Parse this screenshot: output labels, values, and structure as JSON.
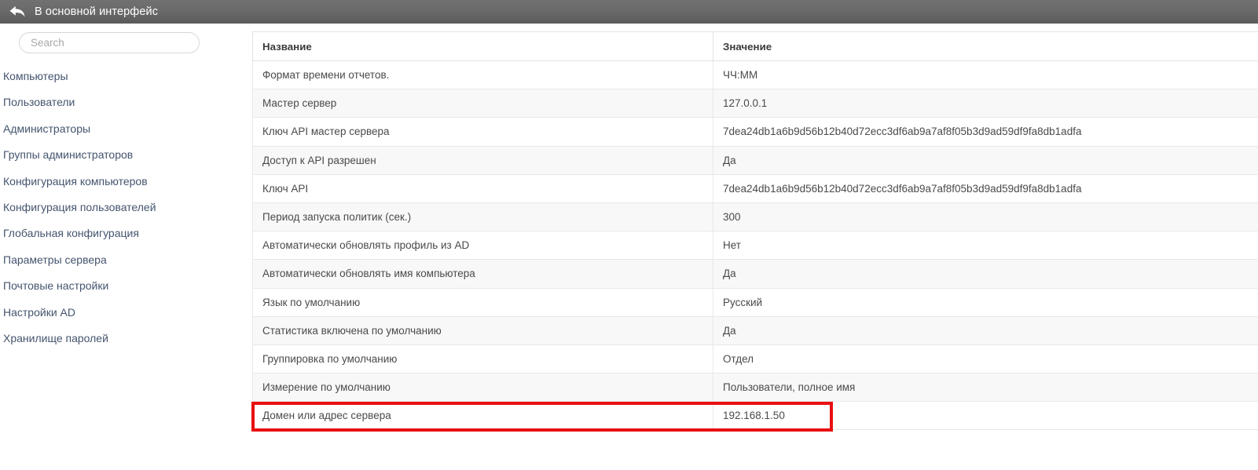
{
  "topbar": {
    "back_label": "В основной интерфейс",
    "back_icon": "back-arrow-icon",
    "bg_color": "#696969"
  },
  "sidebar": {
    "search": {
      "placeholder": "Search",
      "value": ""
    },
    "items": [
      {
        "label": "Компьютеры"
      },
      {
        "label": "Пользователи"
      },
      {
        "label": "Администраторы"
      },
      {
        "label": "Группы администраторов"
      },
      {
        "label": "Конфигурация компьютеров"
      },
      {
        "label": "Конфигурация пользователей"
      },
      {
        "label": "Глобальная конфигурация"
      },
      {
        "label": "Параметры сервера"
      },
      {
        "label": "Почтовые настройки"
      },
      {
        "label": "Настройки AD"
      },
      {
        "label": "Хранилище паролей"
      }
    ],
    "link_color": "#44546e"
  },
  "table": {
    "columns": [
      "Название",
      "Значение"
    ],
    "rows": [
      {
        "name": "Формат времени отчетов.",
        "value": "ЧЧ:ММ"
      },
      {
        "name": "Мастер сервер",
        "value": "127.0.0.1"
      },
      {
        "name": "Ключ API мастер сервера",
        "value": "7dea24db1a6b9d56b12b40d72ecc3df6ab9a7af8f05b3d9ad59df9fa8db1adfa"
      },
      {
        "name": "Доступ к API разрешен",
        "value": "Да"
      },
      {
        "name": "Ключ API",
        "value": "7dea24db1a6b9d56b12b40d72ecc3df6ab9a7af8f05b3d9ad59df9fa8db1adfa"
      },
      {
        "name": "Период запуска политик (сек.)",
        "value": "300"
      },
      {
        "name": "Автоматически обновлять профиль из AD",
        "value": "Нет"
      },
      {
        "name": "Автоматически обновлять имя компьютера",
        "value": "Да"
      },
      {
        "name": "Язык по умолчанию",
        "value": "Русский"
      },
      {
        "name": "Статистика включена по умолчанию",
        "value": "Да"
      },
      {
        "name": "Группировка по умолчанию",
        "value": "Отдел"
      },
      {
        "name": "Измерение по умолчанию",
        "value": "Пользователи, полное имя"
      },
      {
        "name": "Домен или адрес сервера",
        "value": "192.168.1.50"
      }
    ]
  },
  "highlight": {
    "color": "#e81010",
    "target_row_index": 12
  }
}
